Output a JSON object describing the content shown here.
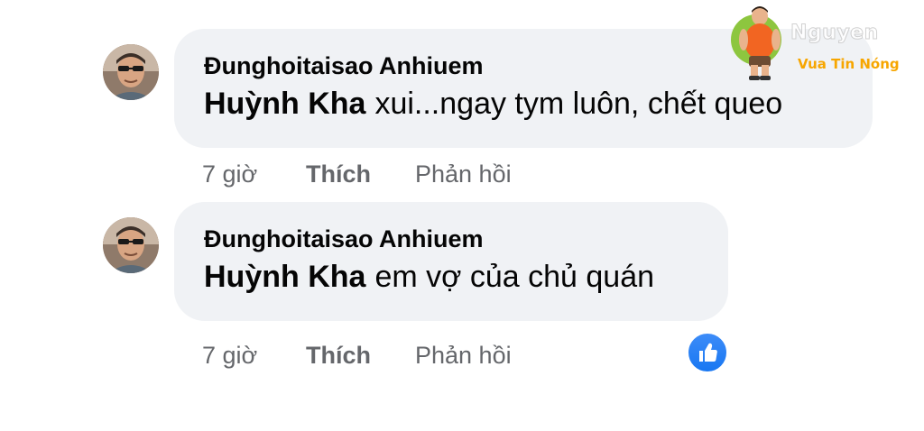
{
  "comments": [
    {
      "author": "Đunghoitaisao Anhiuem",
      "mention": "Huỳnh Kha",
      "message": "xui...ngay tym luôn, chết queo",
      "time": "7 giờ",
      "like_label": "Thích",
      "reply_label": "Phản hồi",
      "reaction": null
    },
    {
      "author": "Đunghoitaisao Anhiuem",
      "mention": "Huỳnh Kha",
      "message": "em vợ của chủ quán",
      "time": "7 giờ",
      "like_label": "Thích",
      "reply_label": "Phản hồi",
      "reaction": "like-icon"
    }
  ],
  "watermark": {
    "brand": "Nguyen",
    "tagline": "Vua Tin Nóng"
  },
  "colors": {
    "bubble": "#f0f2f5",
    "text": "#050505",
    "secondary": "#65676b",
    "like_blue": "#1877f2",
    "tagline_orange": "#f7a600"
  }
}
